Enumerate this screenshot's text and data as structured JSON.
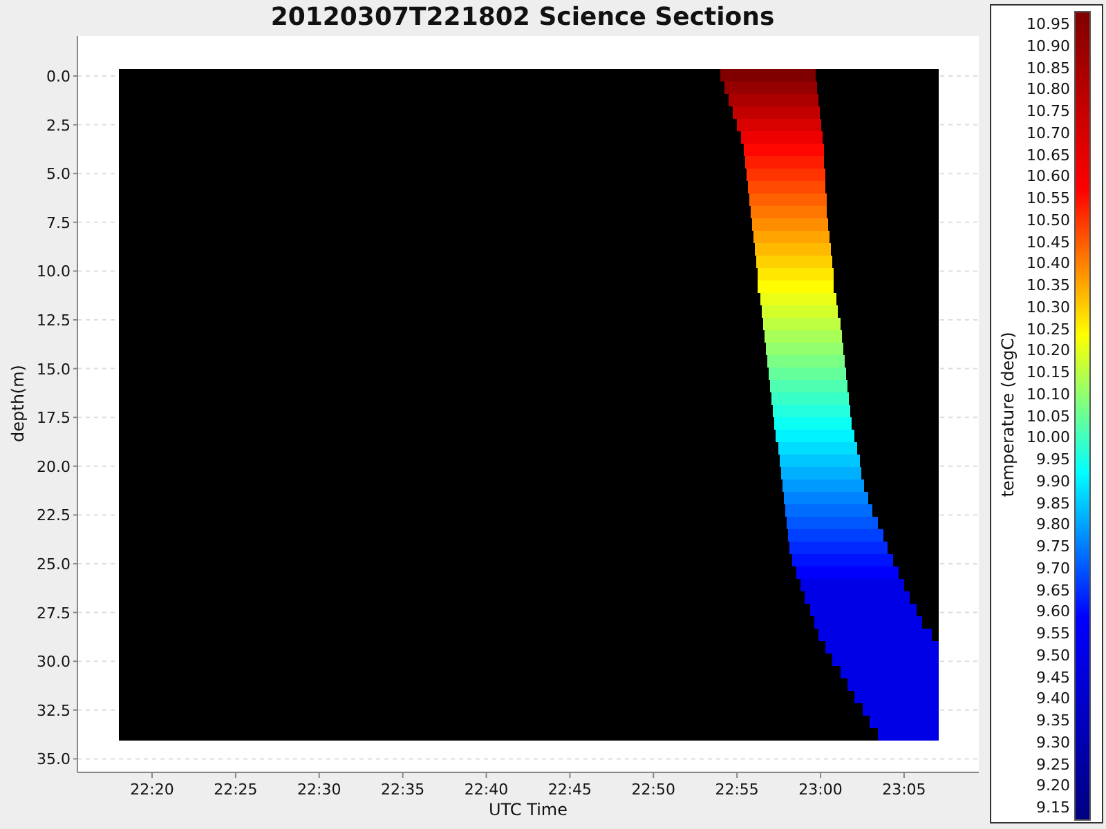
{
  "title": "20120307T221802 Science Sections",
  "y_axis": {
    "label": "depth(m)",
    "ticks": [
      "0.0",
      "2.5",
      "5.0",
      "7.5",
      "10.0",
      "12.5",
      "15.0",
      "17.5",
      "20.0",
      "22.5",
      "25.0",
      "27.5",
      "30.0",
      "32.5",
      "35.0"
    ]
  },
  "x_axis": {
    "label": "UTC Time",
    "ticks": [
      "22:20",
      "22:25",
      "22:30",
      "22:35",
      "22:40",
      "22:45",
      "22:50",
      "22:55",
      "23:00",
      "23:05"
    ]
  },
  "colorbar": {
    "label": "temperature (degC)",
    "ticks": [
      "10.95",
      "10.90",
      "10.85",
      "10.80",
      "10.75",
      "10.70",
      "10.65",
      "10.60",
      "10.55",
      "10.50",
      "10.45",
      "10.40",
      "10.35",
      "10.30",
      "10.25",
      "10.20",
      "10.15",
      "10.10",
      "10.05",
      "10.00",
      "9.95",
      "9.90",
      "9.85",
      "9.80",
      "9.75",
      "9.70",
      "9.65",
      "9.60",
      "9.55",
      "9.50",
      "9.45",
      "9.40",
      "9.35",
      "9.30",
      "9.25",
      "9.20",
      "9.15"
    ]
  }
}
